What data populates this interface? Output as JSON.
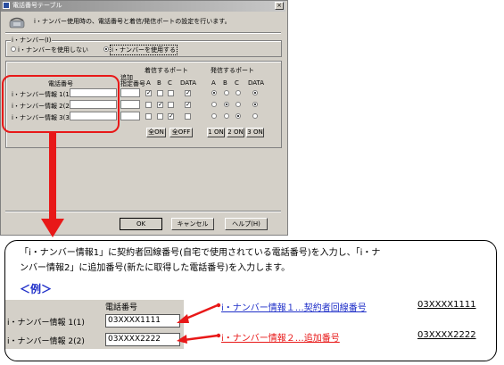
{
  "dialog": {
    "title": "電話番号テーブル",
    "close": "×",
    "description": "i・ナンバー使用時の、電話番号と着信/発信ポートの設定を行います。",
    "inumber_group": "i・ナンバー(I)",
    "radio_off": "i・ナンバーを使用しない",
    "radio_on": "i・ナンバーを使用する",
    "selected": "on"
  },
  "table": {
    "col_phone": "電話番号",
    "col_extra_top": "追加",
    "col_extra": "指定番号",
    "incoming_header": "着信するポート",
    "outgoing_header": "発信するポート",
    "port_labels": [
      "A",
      "B",
      "C",
      "DATA"
    ],
    "rows": [
      {
        "label": "i・ナンバー情報 1(1)",
        "incoming": [
          true,
          false,
          false,
          true
        ],
        "outgoing": 0
      },
      {
        "label": "i・ナンバー情報 2(2)",
        "incoming": [
          false,
          true,
          false,
          true
        ],
        "outgoing": 1
      },
      {
        "label": "i・ナンバー情報 3(3)",
        "incoming": [
          false,
          false,
          true,
          false
        ],
        "outgoing": 2
      }
    ],
    "all_on": "全ON",
    "all_off": "全OFF",
    "out_buttons": [
      "1 ON",
      "2 ON",
      "3 ON"
    ]
  },
  "footer": {
    "ok": "OK",
    "cancel": "キャンセル",
    "help": "ヘルプ(H)"
  },
  "annotation": {
    "instruction_line1": "「i・ナンバー情報1」に契約者回線番号(自宅で使用されている電話番号)を入力し、「i・ナ",
    "instruction_line2": "ンバー情報2」に追加番号(新たに取得した電話番号)を入力します。",
    "example_title": "＜例＞",
    "example_header": "電話番号",
    "example_rows": [
      {
        "label": "i・ナンバー情報 1(1)",
        "value": "03XXXX1111"
      },
      {
        "label": "i・ナンバー情報 2(2)",
        "value": "03XXXX2222"
      }
    ],
    "note1_label": "i・ナンバー情報１…契約者回線番号",
    "note1_value": "03XXXX1111",
    "note2_label": "i・ナンバー情報２…追加番号",
    "note2_value": "03XXXX2222"
  },
  "colors": {
    "accent_red": "#e81818",
    "link_blue": "#1e2ec8",
    "dialog_bg": "#d4d0c8"
  }
}
